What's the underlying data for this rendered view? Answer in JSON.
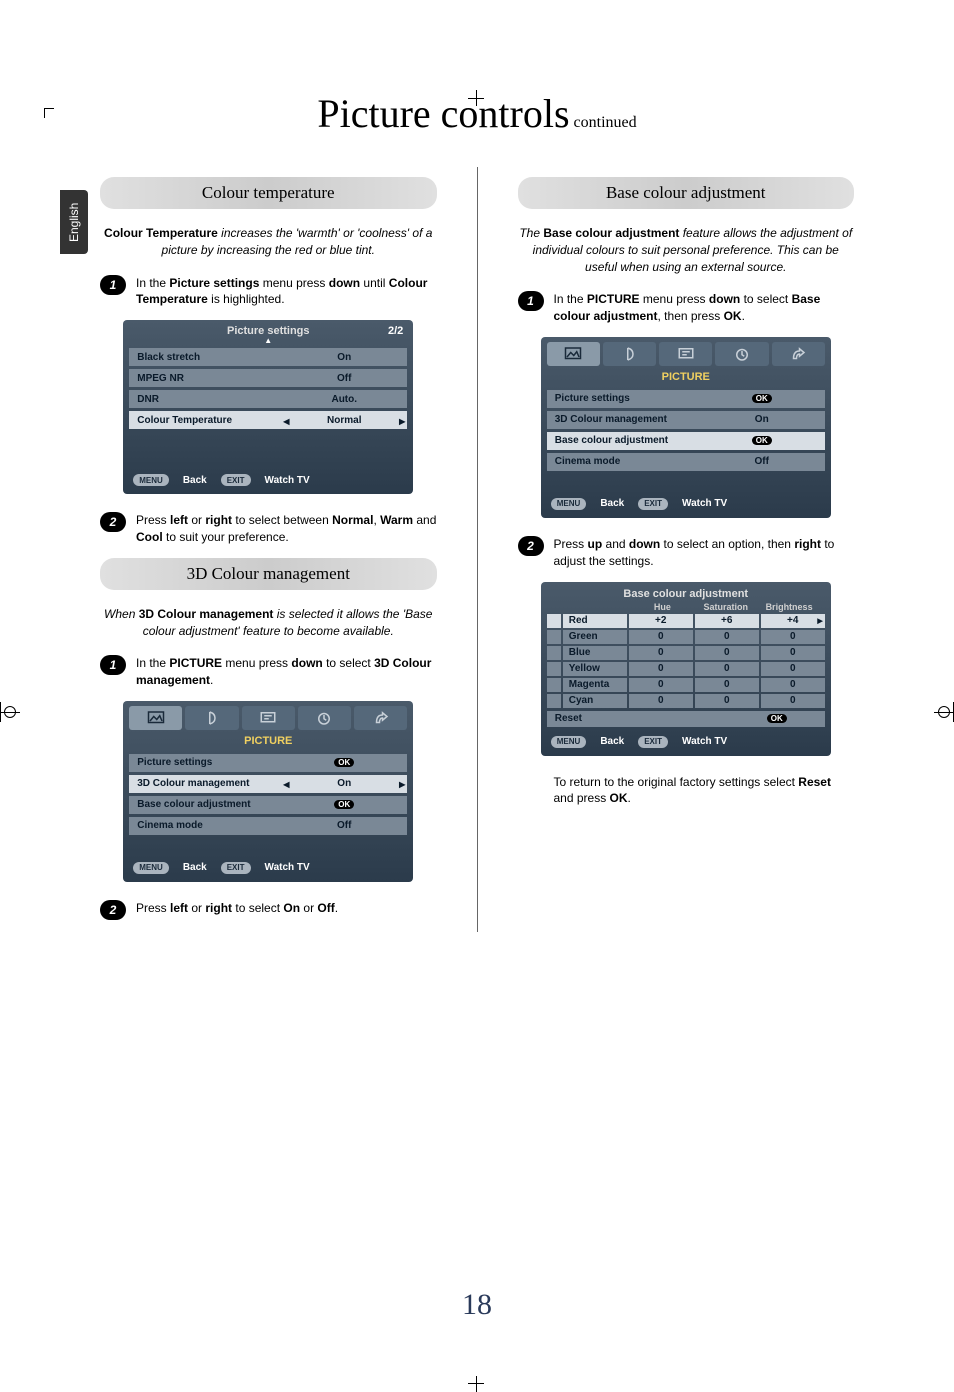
{
  "language_tab": "English",
  "title_main": "Picture controls",
  "title_cont": "continued",
  "page_number": "18",
  "left": {
    "s1": {
      "heading": "Colour temperature",
      "intro_prefix": "Colour Temperature",
      "intro_rest": " increases the 'warmth' or 'coolness' of a picture by increasing the red or blue tint.",
      "step1_a": "In the ",
      "step1_b": "Picture settings",
      "step1_c": " menu press ",
      "step1_d": "down",
      "step1_e": " until ",
      "step1_f": "Colour Temperature",
      "step1_g": " is highlighted.",
      "osd": {
        "title": "Picture settings",
        "pager": "2/2",
        "rows": [
          {
            "label": "Black stretch",
            "val": "On"
          },
          {
            "label": "MPEG NR",
            "val": "Off"
          },
          {
            "label": "DNR",
            "val": "Auto."
          },
          {
            "label": "Colour Temperature",
            "val": "Normal",
            "selected": true,
            "arrows": true
          }
        ],
        "foot_menu": "MENU",
        "foot_back": "Back",
        "foot_exit": "EXIT",
        "foot_watch": "Watch TV"
      },
      "step2_a": "Press ",
      "step2_b": "left",
      "step2_c": " or ",
      "step2_d": "right",
      "step2_e": " to select between ",
      "step2_f": "Normal",
      "step2_g": ", ",
      "step2_h": "Warm",
      "step2_i": " and ",
      "step2_j": "Cool",
      "step2_k": " to suit your preference."
    },
    "s2": {
      "heading": "3D Colour management",
      "intro_a": "When ",
      "intro_b": "3D Colour management",
      "intro_c": " is selected it allows the 'Base colour adjustment' feature to become available.",
      "step1_a": "In the ",
      "step1_b": "PICTURE",
      "step1_c": " menu press ",
      "step1_d": "down",
      "step1_e": " to select ",
      "step1_f": "3D Colour management",
      "step1_g": ".",
      "osd": {
        "cat": "PICTURE",
        "rows": [
          {
            "label": "Picture settings",
            "val": "OK",
            "ok": true
          },
          {
            "label": "3D Colour management",
            "val": "On",
            "selected": true,
            "arrows": true
          },
          {
            "label": "Base colour adjustment",
            "val": "OK",
            "ok": true
          },
          {
            "label": "Cinema mode",
            "val": "Off"
          }
        ],
        "foot_menu": "MENU",
        "foot_back": "Back",
        "foot_exit": "EXIT",
        "foot_watch": "Watch TV"
      },
      "step2_a": "Press ",
      "step2_b": "left",
      "step2_c": " or ",
      "step2_d": "right",
      "step2_e": " to select ",
      "step2_f": "On",
      "step2_g": " or ",
      "step2_h": "Off",
      "step2_i": "."
    }
  },
  "right": {
    "s1": {
      "heading": "Base colour adjustment",
      "intro_a": "The ",
      "intro_b": "Base colour adjustment",
      "intro_c": " feature allows the adjustment of individual colours to suit personal preference. This can be useful when using an external source.",
      "step1_a": "In the ",
      "step1_b": "PICTURE",
      "step1_c": " menu press ",
      "step1_d": "down",
      "step1_e": " to select ",
      "step1_f": "Base colour adjustment",
      "step1_g": ", then press ",
      "step1_h": "OK",
      "step1_i": ".",
      "osd": {
        "cat": "PICTURE",
        "rows": [
          {
            "label": "Picture settings",
            "val": "OK",
            "ok": true
          },
          {
            "label": "3D Colour management",
            "val": "On"
          },
          {
            "label": "Base colour adjustment",
            "val": "OK",
            "ok": true,
            "selected": true
          },
          {
            "label": "Cinema mode",
            "val": "Off"
          }
        ],
        "foot_menu": "MENU",
        "foot_back": "Back",
        "foot_exit": "EXIT",
        "foot_watch": "Watch TV"
      },
      "step2_a": "Press ",
      "step2_b": "up",
      "step2_c": " and ",
      "step2_d": "down",
      "step2_e": " to select an option, then ",
      "step2_f": "right",
      "step2_g": " to adjust the settings.",
      "adj": {
        "title": "Base colour adjustment",
        "cols": [
          "Hue",
          "Saturation",
          "Brightness"
        ],
        "rows": [
          {
            "name": "Red",
            "vals": [
              "+2",
              "+6",
              "+4"
            ],
            "selected": true,
            "arrow_r": true
          },
          {
            "name": "Green",
            "vals": [
              "0",
              "0",
              "0"
            ]
          },
          {
            "name": "Blue",
            "vals": [
              "0",
              "0",
              "0"
            ]
          },
          {
            "name": "Yellow",
            "vals": [
              "0",
              "0",
              "0"
            ]
          },
          {
            "name": "Magenta",
            "vals": [
              "0",
              "0",
              "0"
            ]
          },
          {
            "name": "Cyan",
            "vals": [
              "0",
              "0",
              "0"
            ]
          }
        ],
        "reset": "Reset",
        "reset_ok": "OK",
        "foot_menu": "MENU",
        "foot_back": "Back",
        "foot_exit": "EXIT",
        "foot_watch": "Watch TV"
      },
      "outro_a": "To return to the original factory settings select ",
      "outro_b": "Reset",
      "outro_c": " and press ",
      "outro_d": "OK",
      "outro_e": "."
    }
  },
  "step_labels": {
    "one": "1",
    "two": "2"
  }
}
